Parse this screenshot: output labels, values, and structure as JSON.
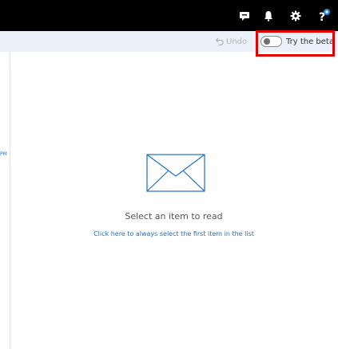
{
  "topbar": {
    "icons": [
      "chat-icon",
      "bell-icon",
      "gear-icon",
      "help-icon"
    ]
  },
  "command_bar": {
    "undo_label": "Undo",
    "try_beta_label": "Try the beta",
    "beta_toggle_on": false
  },
  "message_list": {
    "partial_time": "PM"
  },
  "reading_pane": {
    "empty_title": "Select an item to read",
    "empty_link": "Click here to always select the first item in the list"
  },
  "colors": {
    "topbar": "#000000",
    "command_bar": "#eaf1fa",
    "accent": "#1e6fc5",
    "highlight_box": "#e00000"
  }
}
